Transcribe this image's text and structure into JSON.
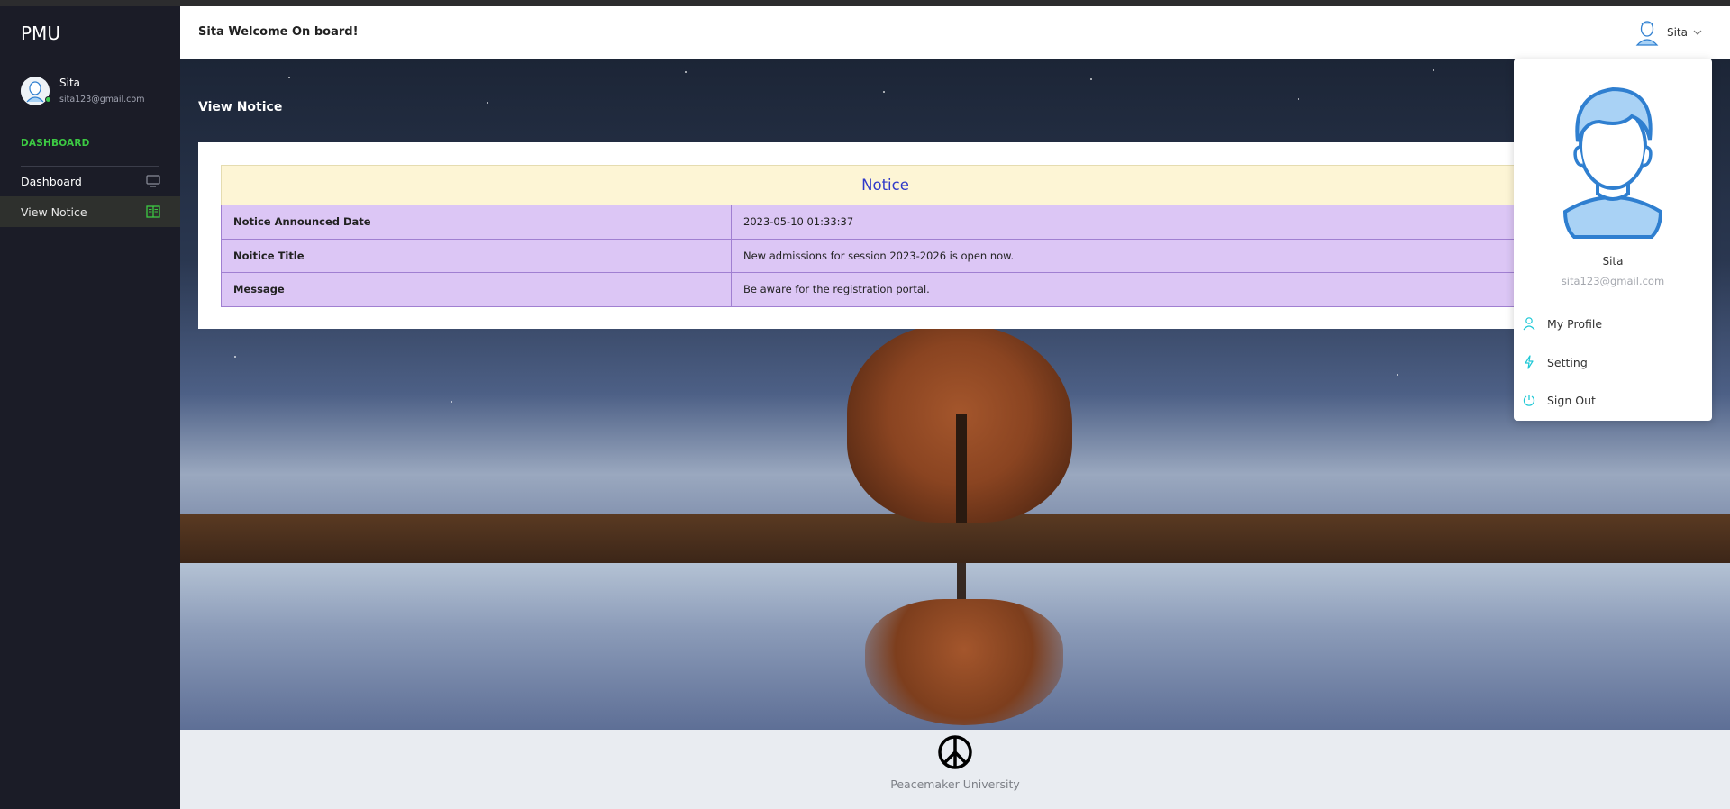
{
  "sidebar": {
    "brand": "PMU",
    "user": {
      "name": "Sita",
      "email": "sita123@gmail.com"
    },
    "section_label": "DASHBOARD",
    "items": [
      {
        "label": "Dashboard",
        "icon": "monitor-icon"
      },
      {
        "label": "View Notice",
        "icon": "book-icon",
        "active": true
      }
    ],
    "accent_color": "#3cc943"
  },
  "topbar": {
    "welcome": "Sita Welcome On board!",
    "user_name": "Sita"
  },
  "main": {
    "page_title": "View Notice",
    "notice": {
      "heading": "Notice",
      "rows": [
        {
          "label": "Notice Announced Date",
          "value": "2023-05-10 01:33:37"
        },
        {
          "label": "Noitice Title",
          "value": "New admissions for session 2023-2026 is open now."
        },
        {
          "label": "Message",
          "value": "Be aware for the registration portal."
        }
      ]
    }
  },
  "footer": {
    "icon": "peace-icon",
    "text": "Peacemaker University"
  },
  "dropdown": {
    "name": "Sita",
    "email": "sita123@gmail.com",
    "items": [
      {
        "label": "My Profile",
        "icon": "user-icon"
      },
      {
        "label": "Setting",
        "icon": "bolt-icon"
      },
      {
        "label": "Sign Out",
        "icon": "power-icon"
      }
    ],
    "icon_color": "#1ec8d6"
  }
}
